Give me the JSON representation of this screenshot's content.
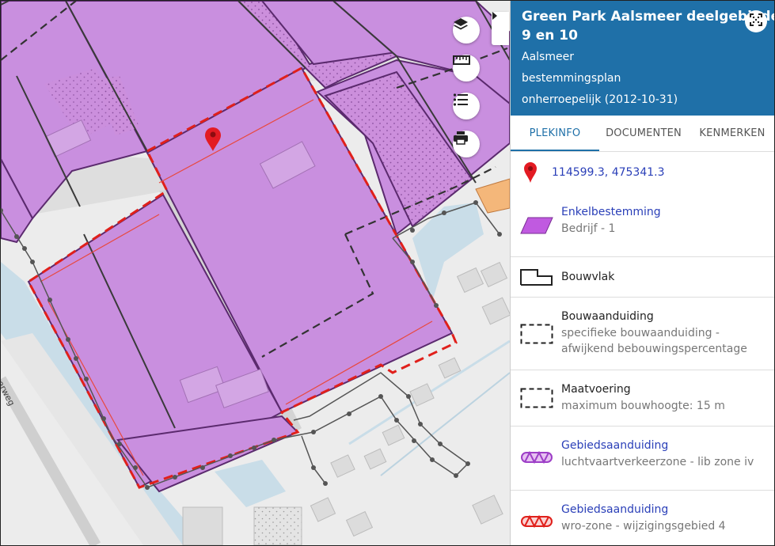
{
  "map": {
    "road_label": "werweg",
    "controls": {
      "layers": "layers-icon",
      "measure": "ruler-icon",
      "legend": "list-icon",
      "print": "print-icon",
      "collapse": "chevron-right-icon"
    },
    "colors": {
      "bestemming": "#c98fdf",
      "bestemming_stroke": "#5b2a6e",
      "plangebied": "#e0201b",
      "orange_zone": "#f4b77a",
      "water": "#c9dde8",
      "background": "#ececec"
    }
  },
  "panel": {
    "title_line1": "Green Park Aalsmeer deelgebieden",
    "title_line2": "9 en 10",
    "municipality": "Aalsmeer",
    "plan_type": "bestemmingsplan",
    "status": "onherroepelijk (2012-10-31)",
    "fullscreen_icon": "expand-icon",
    "tabs": [
      "PLEKINFO",
      "DOCUMENTEN",
      "KENMERKEN"
    ],
    "active_tab": "PLEKINFO",
    "coordinates": "114599.3, 475341.3",
    "items": [
      {
        "title": "Enkelbestemming",
        "subtitle": "Bedrijf - 1",
        "icon": "purple-parallelogram-icon",
        "link": true
      },
      {
        "title": "Bouwvlak",
        "subtitle": "",
        "icon": "bouwvlak-outline-icon",
        "link": false
      },
      {
        "title": "Bouwaanduiding",
        "subtitle": "specifieke bouwaanduiding - afwijkend bebouwingspercentage",
        "subtitle_line1": "specifieke bouwaanduiding -",
        "subtitle_line2": "afwijkend bebouwingspercentage",
        "icon": "dashed-rect-icon",
        "link": false
      },
      {
        "title": "Maatvoering",
        "subtitle": "maximum bouwhoogte: 15 m",
        "icon": "dashed-rect-icon",
        "link": false
      },
      {
        "title": "Gebiedsaanduiding",
        "subtitle": "luchtvaartverkeerzone - lib zone iv",
        "icon": "purple-zone-icon",
        "link": true
      },
      {
        "title": "Gebiedsaanduiding",
        "subtitle": "wro-zone - wijzigingsgebied 4",
        "icon": "red-zone-icon",
        "link": true
      }
    ]
  }
}
